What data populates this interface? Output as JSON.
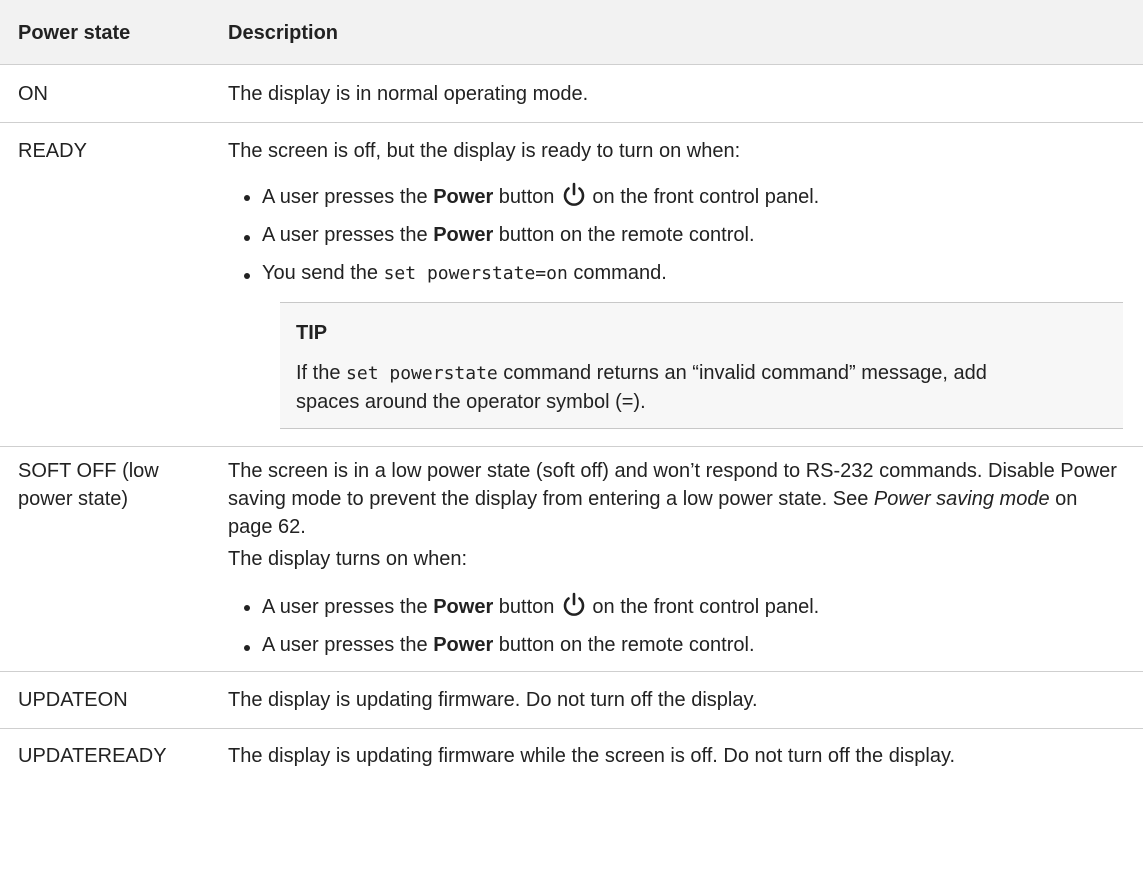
{
  "header": {
    "col1": "Power state",
    "col2": "Description"
  },
  "rows": {
    "on": {
      "state": "ON",
      "desc": "The display is in normal operating mode."
    },
    "ready": {
      "state": "READY",
      "intro": "The screen is off, but the display is ready to turn on when:",
      "b1_pre": "A user presses the ",
      "b1_bold": "Power",
      "b1_mid": " button",
      "b1_post": "on the front control panel.",
      "b2_pre": "A user presses the ",
      "b2_bold": "Power",
      "b2_post": " button on the remote control.",
      "b3_pre": "You send the ",
      "b3_code": "set powerstate=on",
      "b3_post": " command.",
      "tip_title": "TIP",
      "tip_pre": "If the ",
      "tip_code": "set powerstate",
      "tip_post": " command returns an “invalid command” message, add spaces around the operator symbol (=)."
    },
    "soft_off": {
      "state": "SOFT OFF (low power state)",
      "p1_pre": "The screen is in a low power state (soft off) and won’t respond to RS-232 commands. Disable Power saving mode to prevent the display from entering a low power state. See ",
      "p1_link": "Power saving mode",
      "p1_post": " on page 62.",
      "p2": "The display turns on when:",
      "b1_pre": "A user presses the ",
      "b1_bold": "Power",
      "b1_mid": " button",
      "b1_post": "on the front control panel.",
      "b2_pre": "A user presses the ",
      "b2_bold": "Power",
      "b2_post": " button on the remote control."
    },
    "updateon": {
      "state": "UPDATEON",
      "desc": "The display is updating firmware. Do not turn off the display."
    },
    "updateready": {
      "state": "UPDATEREADY",
      "desc": "The display is updating firmware while the screen is off. Do not turn off the display."
    }
  },
  "icons": {
    "power": "power-icon"
  }
}
